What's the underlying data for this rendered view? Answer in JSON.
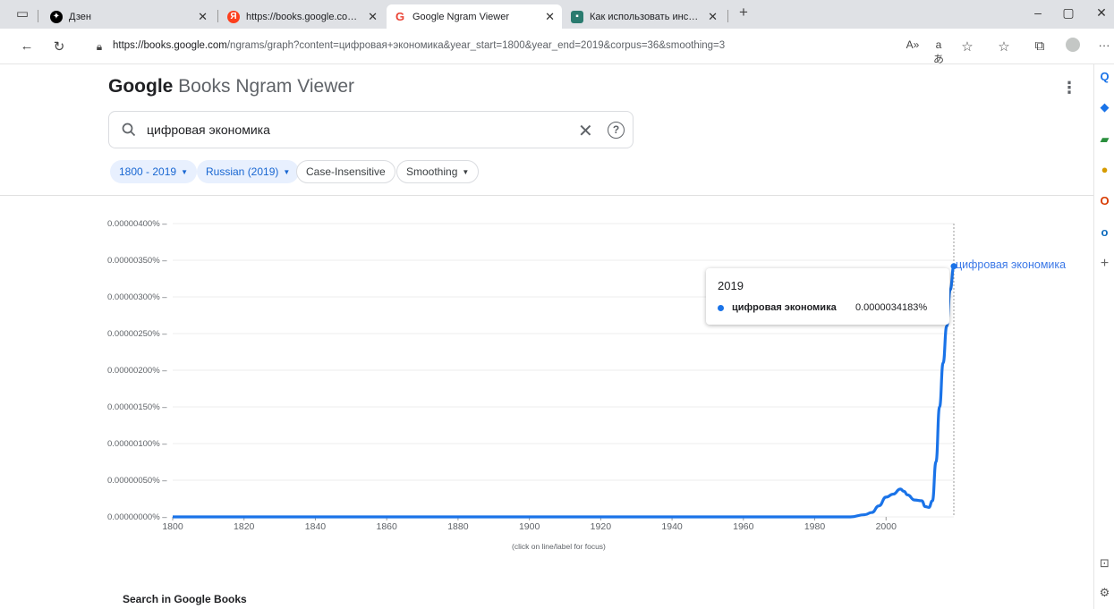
{
  "browser": {
    "tabs": [
      {
        "title": "Дзен",
        "icon": "dzen-icon"
      },
      {
        "title": "https://books.google.com/ngram",
        "icon": "yandex-icon"
      },
      {
        "title": "Google Ngram Viewer",
        "icon": "google-icon",
        "active": true
      },
      {
        "title": "Как использовать инструмент г",
        "icon": "site-icon"
      }
    ],
    "url_host": "https://books.google.com",
    "url_path": "/ngrams/graph?content=цифровая+экономика&year_start=1800&year_end=2019&corpus=36&smoothing=3"
  },
  "app": {
    "logo_google": "Google",
    "logo_rest": " Books Ngram Viewer",
    "search_value": "цифровая экономика",
    "chips": {
      "years": "1800 - 2019",
      "corpus": "Russian (2019)",
      "case": "Case-Insensitive",
      "smoothing": "Smoothing"
    },
    "click_hint": "(click on line/label for focus)",
    "series_label": "цифровая экономика",
    "tooltip": {
      "year": "2019",
      "name": "цифровая экономика",
      "value": "0.0000034183%"
    },
    "books_title": "Search in Google Books"
  },
  "colors": {
    "series": "#1a73e8",
    "accent": "#1967d2"
  },
  "chart_data": {
    "type": "line",
    "xlim": [
      1800,
      2019
    ],
    "ylim": [
      0,
      4e-06
    ],
    "y_unit": "%",
    "y_ticks": [
      "0.00000000%",
      "0.00000050%",
      "0.00000100%",
      "0.00000150%",
      "0.00000200%",
      "0.00000250%",
      "0.00000300%",
      "0.00000350%",
      "0.00000400%"
    ],
    "x_ticks": [
      1800,
      1820,
      1840,
      1860,
      1880,
      1900,
      1920,
      1940,
      1960,
      1980,
      2000
    ],
    "grid": true,
    "series": [
      {
        "name": "цифровая экономика",
        "x": [
          1800,
          1990,
          1994,
          1996,
          1998,
          2000,
          2002,
          2004,
          2005,
          2006,
          2008,
          2010,
          2011,
          2012,
          2013,
          2014,
          2015,
          2016,
          2017,
          2018,
          2019
        ],
        "y": [
          0,
          0,
          3e-08,
          6e-08,
          1.5e-07,
          2.7e-07,
          3.1e-07,
          3.8e-07,
          3.5e-07,
          3e-07,
          2.3e-07,
          2.2e-07,
          1.4e-07,
          1.3e-07,
          2.2e-07,
          7.5e-07,
          1.5e-06,
          2.1e-06,
          2.6e-06,
          3.1e-06,
          3.4183e-06
        ]
      }
    ]
  }
}
